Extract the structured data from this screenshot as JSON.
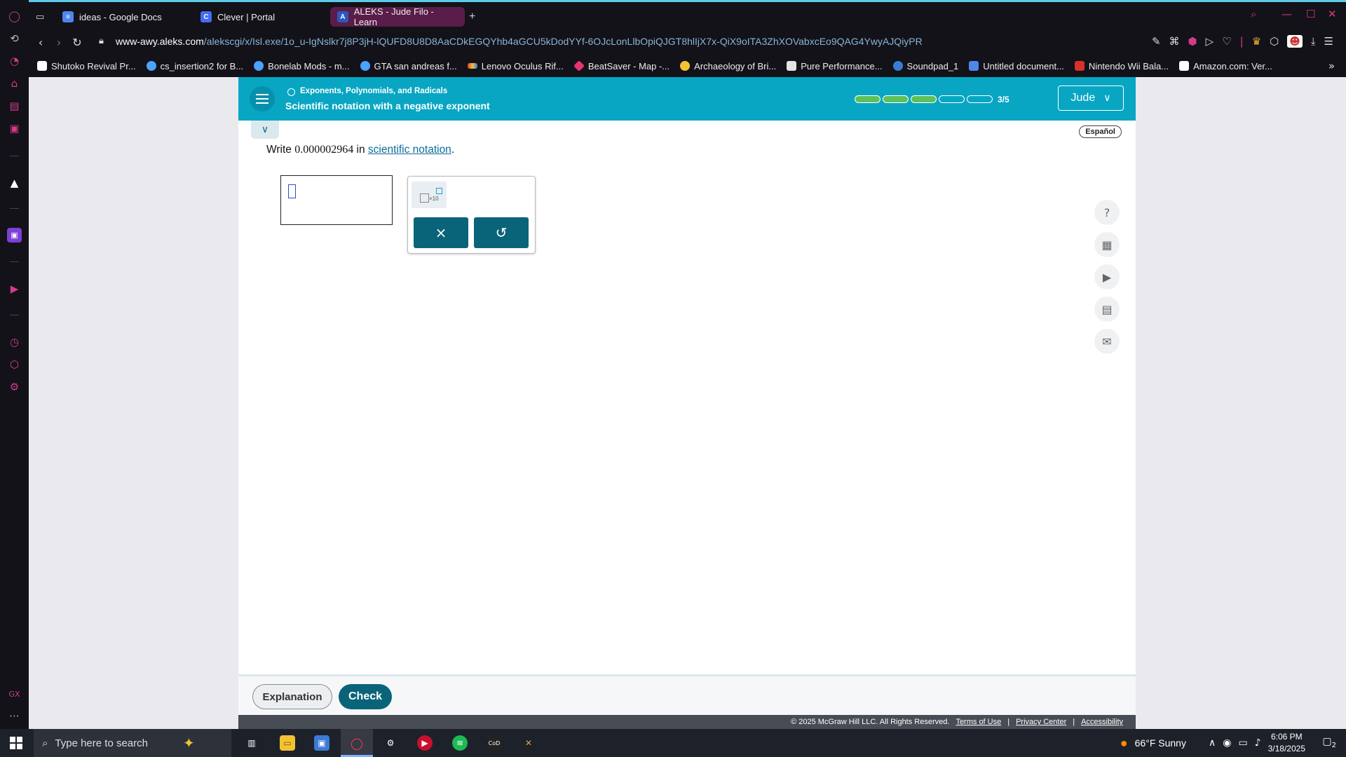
{
  "browser": {
    "tabs": [
      {
        "label": "ideas - Google Docs",
        "icon": "docs-icon",
        "color": "#4f86ec"
      },
      {
        "label": "Clever | Portal",
        "icon": "clever-icon",
        "color": "#436cf2"
      },
      {
        "label": "ALEKS - Jude Filo - Learn",
        "icon": "aleks-icon",
        "color": "#2a58c2",
        "active": true
      }
    ],
    "new_tab": "+",
    "url_host": "www-awy.aleks.com",
    "url_path": "/alekscgi/x/Isl.exe/1o_u-IgNslkr7j8P3jH-lQUFD8U8D8AaCDkEGQYhb4aGCU5kDodYYf-6OJcLonLlbOpiQJGT8hlIjX7x-QiX9oITA3ZhXOVabxcEo9QAG4YwyAJQiyPR",
    "bookmarks": [
      {
        "label": "Shutoko Revival Pr...",
        "color": "#ffffff"
      },
      {
        "label": "cs_insertion2 for B...",
        "color": "#4aa3ff"
      },
      {
        "label": "Bonelab Mods - m...",
        "color": "#4aa3ff"
      },
      {
        "label": "GTA san andreas f...",
        "color": "#4aa3ff"
      },
      {
        "label": "Lenovo Oculus Rif...",
        "color": "#e03a3a"
      },
      {
        "label": "BeatSaver - Map -...",
        "color": "#e8336f"
      },
      {
        "label": "Archaeology of Bri...",
        "color": "#f2c233"
      },
      {
        "label": "Pure Performance...",
        "color": "#e4e4e4"
      },
      {
        "label": "Soundpad_1",
        "color": "#3a7bd5"
      },
      {
        "label": "Untitled document...",
        "color": "#4f86ec"
      },
      {
        "label": "Nintendo Wii Bala...",
        "color": "#d9302c"
      },
      {
        "label": "Amazon.com: Ver...",
        "color": "#ffffff"
      }
    ]
  },
  "aleks": {
    "topic": "Exponents, Polynomials, and Radicals",
    "subtopic": "Scientific notation with a negative exponent",
    "progress": {
      "completed": 3,
      "total": 5,
      "label": "3/5"
    },
    "user": "Jude",
    "language_link": "Español",
    "question": {
      "prefix": "Write",
      "number": "0.000002964",
      "middle": "in",
      "link": "scientific notation",
      "suffix": "."
    },
    "keypad": {
      "sci_label": "×10",
      "clear_symbol": "×",
      "undo_symbol": "↺"
    },
    "tools": [
      "help-icon",
      "calculator-icon",
      "video-icon",
      "textbook-icon",
      "message-icon"
    ],
    "buttons": {
      "explanation": "Explanation",
      "check": "Check"
    },
    "legal": {
      "copyright": "© 2025 McGraw Hill LLC. All Rights Reserved.",
      "terms": "Terms of Use",
      "privacy": "Privacy Center",
      "accessibility": "Accessibility",
      "separator": "|"
    }
  },
  "taskbar": {
    "search_placeholder": "Type here to search",
    "weather": "66°F  Sunny",
    "time": "6:06 PM",
    "date": "3/18/2025",
    "notifications": "2"
  }
}
